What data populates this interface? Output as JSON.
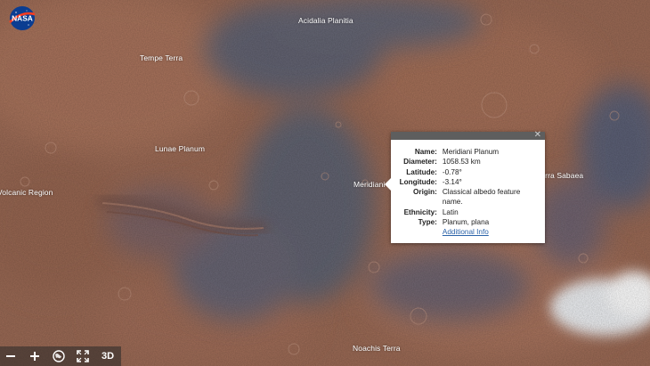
{
  "map": {
    "labels": {
      "acidalia": "Acidalia Planitia",
      "tempe": "Tempe Terra",
      "lunae": "Lunae Planum",
      "volcanic": "Volcanic Region",
      "meridiani": "Meridiani",
      "sabaea": "Terra Sabaea",
      "noachis": "Noachis Terra"
    }
  },
  "logo": {
    "text": "NASA"
  },
  "popup": {
    "close_glyph": "✕",
    "fields": {
      "name_label": "Name:",
      "name_value": "Meridiani Planum",
      "diameter_label": "Diameter:",
      "diameter_value": "1058.53 km",
      "latitude_label": "Latitude:",
      "latitude_value": "-0.78°",
      "longitude_label": "Longitude:",
      "longitude_value": "-3.14°",
      "origin_label": "Origin:",
      "origin_value": "Classical albedo feature name.",
      "ethnicity_label": "Ethnicity:",
      "ethnicity_value": "Latin",
      "type_label": "Type:",
      "type_value": "Planum, plana"
    },
    "link_text": "Additional Info"
  },
  "toolbar": {
    "zoom_out_icon": "minus-icon",
    "zoom_in_icon": "plus-icon",
    "globe_icon": "globe-icon",
    "fullscreen_icon": "expand-icon",
    "view_3d_label": "3D"
  },
  "colors": {
    "terrain_base": "#9a6a55",
    "terrain_dark": "#5b6272",
    "terrain_light": "#b98570",
    "ice_cap": "#f2f2f4",
    "popup_header": "#5e5e5e",
    "link": "#2a62a8",
    "nasa_blue": "#0b3d91",
    "nasa_red": "#fc3d21"
  }
}
